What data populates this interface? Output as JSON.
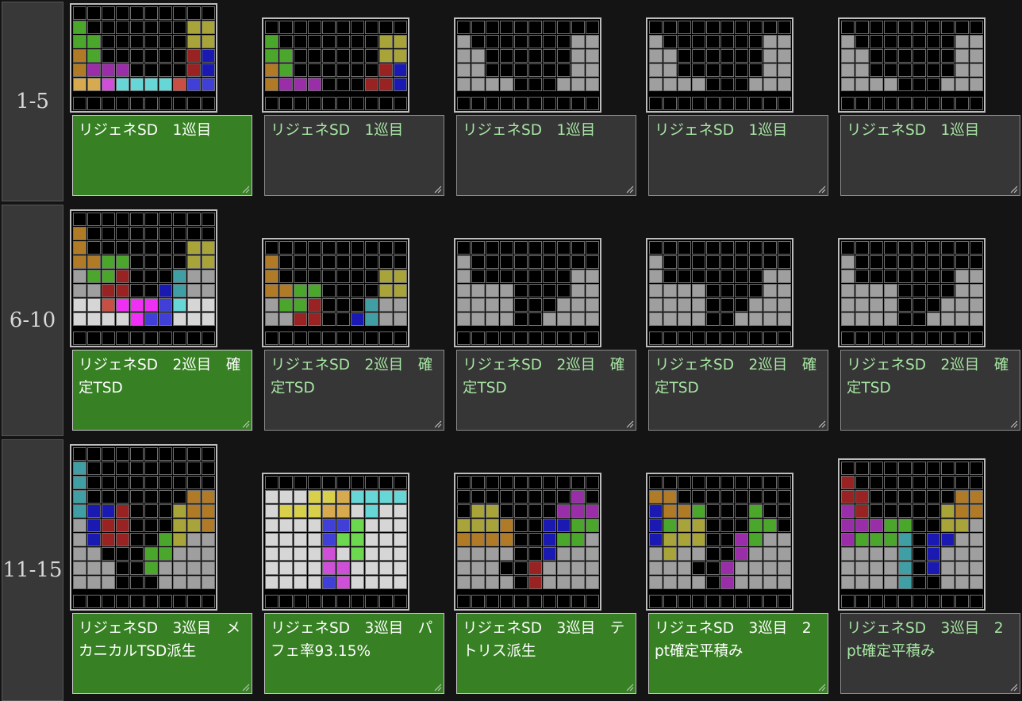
{
  "colors": {
    "L": "#b07a26",
    "Z": "#992222",
    "S": "#4ba62c",
    "J": "#1a1ab3",
    "T": "#9a2ea9",
    "O": "#a8a43a",
    "I": "#3f9fa5",
    "G": "#9f9f9f",
    "W": "#d6d6d6",
    "l": "#d7aa50",
    "z": "#c94e44",
    "s": "#6bd84f",
    "j": "#4040d8",
    "t": "#cf4fd8",
    "i": "#66d6d6",
    "o": "#d8d04a",
    "m": "#f02ff5",
    "empty": "#000000",
    "grid_line": "#6e6e6e",
    "highlight_memo": "#378023",
    "normal_memo": "#363636",
    "memo_text_normal": "#a7e6a3",
    "memo_text_highlight": "#ffffff"
  },
  "rows": [
    {
      "label": "1-5",
      "items": [
        {
          "rows": [
            "..........",
            "S.......OO",
            "SS......OO",
            "LS......ZJ",
            "LTTT....ZJ",
            "lltiiiizjj"
          ],
          "memo": "リジェネSD　1巡目",
          "highlight": true
        },
        {
          "rows": [
            "..........",
            "S.......OO",
            "SS......OO",
            "LS......ZJ",
            "LTTT...ZZJ"
          ],
          "memo": "リジェネSD　1巡目",
          "highlight": false
        },
        {
          "rows": [
            "..........",
            "G.......GG",
            "GG......GG",
            "GG......GG",
            "GGGG...GGG"
          ],
          "memo": "リジェネSD　1巡目",
          "highlight": false
        },
        {
          "rows": [
            "..........",
            "G.......GG",
            "GG......GG",
            "GG......GG",
            "GGGG...GGG"
          ],
          "memo": "リジェネSD　1巡目",
          "highlight": false
        },
        {
          "rows": [
            "..........",
            "G.......GG",
            "GG......GG",
            "GG......GG",
            "GGGG...GGG"
          ],
          "memo": "リジェネSD　1巡目",
          "highlight": false
        }
      ]
    },
    {
      "label": "6-10",
      "items": [
        {
          "rows": [
            "..........",
            "L.........",
            "L.......OO",
            "LLSS....OO",
            "GSSZ...IGG",
            "GGZZ..JIGG",
            "WWzmmmjiWW",
            "WWWWmjjWWW"
          ],
          "memo": "リジェネSD　2巡目　確定TSD",
          "highlight": true
        },
        {
          "rows": [
            "..........",
            "L.........",
            "L.......OO",
            "LLSS....OO",
            "GSSZ...IGG",
            "GGZZ..JIGG"
          ],
          "memo": "リジェネSD　2巡目　確定TSD",
          "highlight": false
        },
        {
          "rows": [
            "..........",
            "G.........",
            "G.......GG",
            "GGGG....GG",
            "GGGG...GGG",
            "GGGG..GGGG"
          ],
          "memo": "リジェネSD　2巡目　確定TSD",
          "highlight": false
        },
        {
          "rows": [
            "..........",
            "G.........",
            "G.......GG",
            "GGGG....GG",
            "GGGG...GGG",
            "GGGG..GGGG"
          ],
          "memo": "リジェネSD　2巡目　確定TSD",
          "highlight": false
        },
        {
          "rows": [
            "..........",
            "G.........",
            "G.......GG",
            "GGGG....GG",
            "GGGG...GGG",
            "GGGG..GGGG"
          ],
          "memo": "リジェネSD　2巡目　確定TSD",
          "highlight": false
        }
      ]
    },
    {
      "label": "11-15",
      "items": [
        {
          "rows": [
            "..........",
            "I.........",
            "I.........",
            "I.......LL",
            "IJJZ...OLL",
            "GJZZ...OOL",
            "GJZZ..SOGG",
            "GG...SSGGG",
            "GGG..SGGGG",
            "GGG...GGGG"
          ],
          "memo": "リジェネSD　3巡目　メカニカルTSD派生",
          "highlight": true
        },
        {
          "rows": [
            "..........",
            "WWWooliiii",
            "WooollWiWW",
            "WWWWjjsWWW",
            "WWWWjssWWW",
            "WWWWtWsWWW",
            "WWWWttWWWW",
            "WWWWjtWWWW"
          ],
          "memo": "リジェネSD　3巡目　パフェ率93.15%",
          "highlight": true
        },
        {
          "rows": [
            "..........",
            "........T.",
            ".OO....TTT",
            "OOOL..JJSS",
            "LLLL..JSSG",
            "GGGG..JGGG",
            "GGG..ZGGGG",
            "GGGG.ZGGGG"
          ],
          "memo": "リジェネSD　3巡目　テトリス派生",
          "highlight": true
        },
        {
          "rows": [
            "..........",
            "LL........",
            "JLLS...S..",
            "JSOO...SS.",
            "JOOO..TSGG",
            "GOGG..TGGG",
            "GGG..TGGGG",
            "GGGG.TGGGG"
          ],
          "memo": "リジェネSD　3巡目　2pt確定平積み",
          "highlight": true
        },
        {
          "rows": [
            "..........",
            "Z.........",
            "ZZ......LL",
            "TZ.....OLL",
            "TTTSS..OOG",
            "TSSSI.JJGG",
            "GGGGI.JGGG",
            "GGGGI.JGGG",
            "GGGGI..GGG"
          ],
          "memo": "リジェネSD　3巡目　2pt確定平積み",
          "highlight": false
        }
      ]
    }
  ]
}
